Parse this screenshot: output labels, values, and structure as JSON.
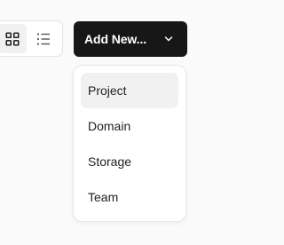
{
  "view_toggle": {
    "grid_icon": "grid-icon",
    "list_icon": "list-icon",
    "selected": "grid"
  },
  "add_new_button": {
    "label": "Add New...",
    "icon": "chevron-down-icon"
  },
  "dropdown": {
    "items": [
      {
        "label": "Project",
        "highlighted": true
      },
      {
        "label": "Domain"
      },
      {
        "label": "Storage"
      },
      {
        "label": "Team"
      }
    ]
  },
  "colors": {
    "button_bg": "#171717",
    "button_text": "#ffffff",
    "highlight_bg": "#f1f1f1",
    "page_bg": "#fafafa"
  }
}
